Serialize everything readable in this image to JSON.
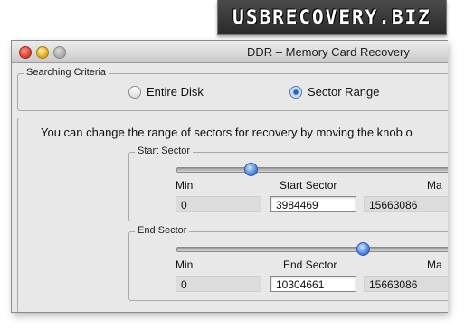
{
  "banner": {
    "text": "USBRECOVERY.BIZ"
  },
  "window": {
    "title": "DDR – Memory Card Recovery"
  },
  "searching_criteria": {
    "legend": "Searching Criteria",
    "options": [
      {
        "label": "Entire Disk",
        "selected": false
      },
      {
        "label": "Sector Range",
        "selected": true
      }
    ]
  },
  "range_panel": {
    "info_text": "You can change the range of sectors for recovery by moving the knob o"
  },
  "start_sector": {
    "legend": "Start Sector",
    "slider_value_fraction": 0.26,
    "min_label": "Min",
    "min_value": "0",
    "value_label": "Start Sector",
    "value": "3984469",
    "max_label": "Ma",
    "max_value": "15663086"
  },
  "end_sector": {
    "legend": "End Sector",
    "slider_value_fraction": 0.66,
    "min_label": "Min",
    "min_value": "0",
    "value_label": "End Sector",
    "value": "10304661",
    "max_label": "Ma",
    "max_value": "15663086"
  }
}
